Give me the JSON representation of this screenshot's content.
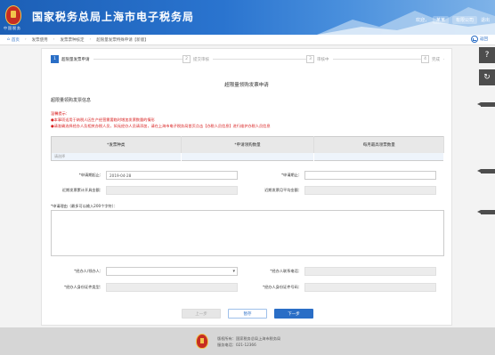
{
  "header": {
    "title": "国家税务总局上海市电子税务局",
    "logo_text": "中国税务",
    "welcome_text": "欢迎，",
    "user_name": "某某",
    "company_label": "有限公司",
    "logout_label": "退出"
  },
  "breadcrumb": {
    "home": "首页",
    "items": [
      "发票使用",
      "发票票种核定",
      "超限量发票特殊申请【新版】"
    ],
    "back_label": "返回"
  },
  "steps": [
    {
      "num": "1",
      "label": "超限量发票申请",
      "active": true
    },
    {
      "num": "2",
      "label": "提交审核",
      "active": false
    },
    {
      "num": "3",
      "label": "审核中",
      "active": false
    },
    {
      "num": "4",
      "label": "完成",
      "active": false
    }
  ],
  "form": {
    "title": "超限量领购发票申请",
    "section_title": "超限量领购发票信息",
    "warning_title": "温馨提示：",
    "warnings": [
      "●本事项适用于纳税人因生产经营需要临时增加发票数量的情形",
      "●请准确选择经办人及相关办税人员，如无经办人员请添加，请在上海市电子税务局首页点击【办税人员信息】进行维护办税人员信息"
    ],
    "table": {
      "headers": [
        "*发票种类",
        "*申请领购数量",
        "每月最高领票数量"
      ],
      "row": [
        "请选择",
        "",
        ""
      ]
    },
    "fields": {
      "start_date_label": "*申请期起止：",
      "start_date_value": "2019-04-28",
      "end_date_label": "*申请期止：",
      "end_date_value": "",
      "prev_amount_label": "近期发票累计开具金额：",
      "prev_amount_value": "",
      "prev_avg_label": "近期发票月平均金额：",
      "prev_avg_value": "",
      "reason_label": "*申请理由（最多可以输入200个字符）：",
      "handler_label": "*经办人/领办人：",
      "handler_value": "",
      "phone_label": "*经办人联系电话：",
      "phone_value": "",
      "id_type_label": "*经办人身份证件类型：",
      "id_type_value": "",
      "id_no_label": "*经办人身份证件号码：",
      "id_no_value": ""
    },
    "buttons": {
      "prev": "上一步",
      "save": "暂存",
      "next": "下一步"
    }
  },
  "footer": {
    "line1": "版权所有：国家税务总局上海市税务局",
    "line2": "服务电话：021-12366"
  },
  "colors": {
    "header_blue": "#1c5fb6",
    "accent": "#2a6ec6",
    "warning": "#d92020"
  },
  "icons": [
    "help-icon",
    "refresh-icon",
    "back-icon"
  ]
}
